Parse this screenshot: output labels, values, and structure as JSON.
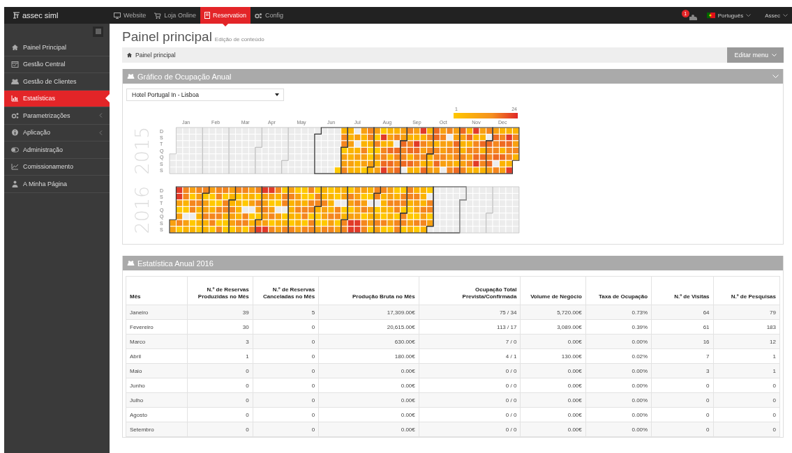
{
  "topbar": {
    "logo": "assec siml",
    "nav": [
      {
        "label": "Website",
        "selected": false
      },
      {
        "label": "Loja Online",
        "selected": false
      },
      {
        "label": "Reservation",
        "selected": true
      },
      {
        "label": "Config",
        "selected": false
      }
    ],
    "notifications": "1",
    "language": "Português",
    "user": "Assec"
  },
  "sidebar": {
    "items": [
      {
        "label": "Painel Principal",
        "selected": false,
        "has_children": false
      },
      {
        "label": "Gestão Central",
        "selected": false,
        "has_children": false
      },
      {
        "label": "Gestão de Clientes",
        "selected": false,
        "has_children": false
      },
      {
        "label": "Estatísticas",
        "selected": true,
        "has_children": false
      },
      {
        "label": "Parametrizações",
        "selected": false,
        "has_children": true
      },
      {
        "label": "Aplicação",
        "selected": false,
        "has_children": true
      },
      {
        "label": "Administração",
        "selected": false,
        "has_children": false
      },
      {
        "label": "Comissionamento",
        "selected": false,
        "has_children": false
      },
      {
        "label": "A Minha Página",
        "selected": false,
        "has_children": false
      }
    ]
  },
  "page": {
    "title": "Painel principal",
    "subtitle": "Edição de conteúdo",
    "breadcrumb": "Painel principal",
    "menu_button": "Editar menu"
  },
  "occupancy_panel": {
    "title": "Gráfico de Ocupação Anual",
    "hotel_select": "Hotel Portugal In - Lisboa",
    "legend_min": "1",
    "legend_max": "24",
    "months": [
      "Jan",
      "Feb",
      "Mar",
      "Apr",
      "May",
      "Jun",
      "Jul",
      "Aug",
      "Sep",
      "Oct",
      "Nov",
      "Dec"
    ],
    "years": [
      {
        "label": "2015",
        "weekdays": [
          "D",
          "S",
          "T",
          "Q",
          "Q",
          "S",
          "S"
        ]
      },
      {
        "label": "2016",
        "weekdays": [
          "D",
          "S",
          "T",
          "Q",
          "Q",
          "S",
          "S"
        ]
      }
    ]
  },
  "stats_panel": {
    "title": "Estatística Anual 2016",
    "columns": [
      "Mês",
      "N.º de Reservas Produzidas no Mês",
      "N.º de Reservas Canceladas no Mês",
      "Produção Bruta no Mês",
      "Ocupação Total Prevista/Confirmada",
      "Volume de Negócio",
      "Taxa de Ocupação",
      "N.º de Visitas",
      "N.º de Pesquisas"
    ],
    "rows": [
      [
        "Janeiro",
        "39",
        "5",
        "17,309.00€",
        "75 / 34",
        "5,720.00€",
        "0.73%",
        "64",
        "79"
      ],
      [
        "Fevereiro",
        "30",
        "0",
        "20,615.00€",
        "113 / 17",
        "3,089.00€",
        "0.39%",
        "61",
        "183"
      ],
      [
        "Marco",
        "3",
        "0",
        "630.00€",
        "7 / 0",
        "0.00€",
        "0.00%",
        "16",
        "12"
      ],
      [
        "Abril",
        "1",
        "0",
        "180.00€",
        "4 / 1",
        "130.00€",
        "0.02%",
        "7",
        "1"
      ],
      [
        "Maio",
        "0",
        "0",
        "0.00€",
        "0 / 0",
        "0.00€",
        "0.00%",
        "3",
        "1"
      ],
      [
        "Junho",
        "0",
        "0",
        "0.00€",
        "0 / 0",
        "0.00€",
        "0.00%",
        "0",
        "0"
      ],
      [
        "Julho",
        "0",
        "0",
        "0.00€",
        "0 / 0",
        "0.00€",
        "0.00%",
        "0",
        "0"
      ],
      [
        "Agosto",
        "0",
        "0",
        "0.00€",
        "0 / 0",
        "0.00€",
        "0.00%",
        "0",
        "0"
      ],
      [
        "Setembro",
        "0",
        "0",
        "0.00€",
        "0 / 0",
        "0.00€",
        "0.00%",
        "0",
        "0"
      ]
    ]
  }
}
